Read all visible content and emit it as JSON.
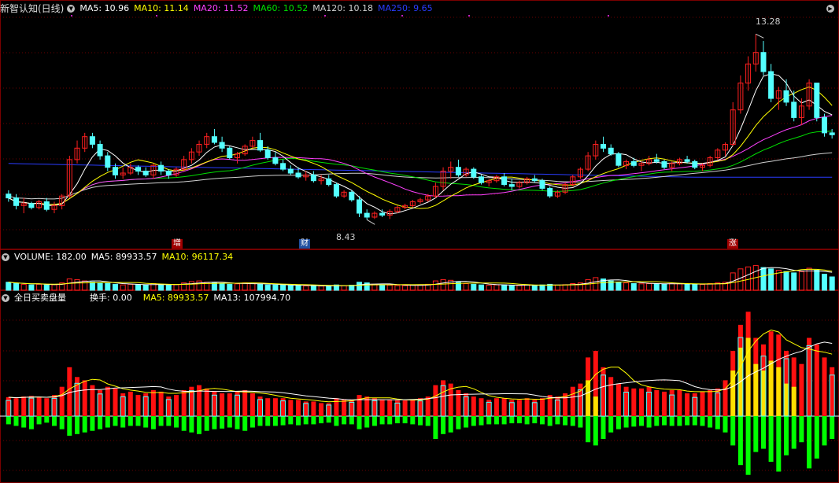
{
  "price_header": {
    "title": "新智认知(日线)",
    "ma5": "MA5: 10.96",
    "ma10": "MA10: 11.14",
    "ma20": "MA20: 11.52",
    "ma60": "MA60: 10.52",
    "ma120": "MA120: 10.18",
    "ma250": "MA250: 9.65"
  },
  "volume_header": {
    "label": "VOLUME: 182.00",
    "ma5": "MA5: 89933.57",
    "ma10": "MA10: 96117.34"
  },
  "flow_header": {
    "label": "全日买卖盘量",
    "turnover": "换手: 0.00",
    "ma5": "MA5: 89933.57",
    "ma13": "MA13: 107994.70"
  },
  "markers": {
    "zeng": "增",
    "cai": "财",
    "zhang": "涨"
  },
  "annotations": {
    "high": "13.28",
    "low": "8.43"
  },
  "colors": {
    "up": "#ff2020",
    "down": "#54ffff",
    "ma5": "#ffffff",
    "ma10": "#ffff00",
    "ma20": "#ff40ff",
    "ma60": "#00e000",
    "ma120": "#d0d0d0",
    "ma250": "#2a3cff",
    "grid": "#6a0000",
    "buy": "#ff1010",
    "sell": "#00ff00",
    "large": "#ffe000"
  },
  "chart_data": {
    "type": "candlestick",
    "price_range": [
      7.8,
      13.8
    ],
    "ohlc": [
      [
        9.1,
        9.2,
        8.9,
        9.0
      ],
      [
        9.0,
        9.1,
        8.7,
        8.8
      ],
      [
        8.8,
        9.0,
        8.6,
        8.85
      ],
      [
        8.85,
        8.9,
        8.7,
        8.75
      ],
      [
        8.75,
        8.95,
        8.7,
        8.9
      ],
      [
        8.9,
        9.0,
        8.65,
        8.7
      ],
      [
        8.7,
        8.9,
        8.6,
        8.8
      ],
      [
        8.8,
        9.1,
        8.7,
        9.05
      ],
      [
        9.05,
        10.1,
        9.0,
        10.0
      ],
      [
        10.0,
        10.5,
        9.9,
        10.3
      ],
      [
        10.3,
        10.7,
        10.2,
        10.6
      ],
      [
        10.6,
        10.7,
        10.3,
        10.4
      ],
      [
        10.4,
        10.5,
        10.0,
        10.1
      ],
      [
        10.1,
        10.2,
        9.7,
        9.8
      ],
      [
        9.8,
        9.9,
        9.5,
        9.6
      ],
      [
        9.6,
        9.8,
        9.5,
        9.65
      ],
      [
        9.65,
        9.9,
        9.6,
        9.8
      ],
      [
        9.8,
        9.85,
        9.6,
        9.7
      ],
      [
        9.7,
        9.8,
        9.55,
        9.6
      ],
      [
        9.6,
        9.9,
        9.5,
        9.85
      ],
      [
        9.85,
        9.95,
        9.6,
        9.7
      ],
      [
        9.7,
        9.75,
        9.5,
        9.6
      ],
      [
        9.6,
        9.8,
        9.55,
        9.75
      ],
      [
        9.75,
        10.1,
        9.7,
        10.0
      ],
      [
        10.0,
        10.3,
        9.9,
        10.2
      ],
      [
        10.2,
        10.5,
        10.1,
        10.4
      ],
      [
        10.4,
        10.7,
        10.3,
        10.6
      ],
      [
        10.6,
        10.8,
        10.4,
        10.45
      ],
      [
        10.45,
        10.6,
        10.2,
        10.3
      ],
      [
        10.3,
        10.35,
        10.0,
        10.05
      ],
      [
        10.05,
        10.2,
        9.9,
        10.15
      ],
      [
        10.15,
        10.4,
        10.1,
        10.35
      ],
      [
        10.35,
        10.6,
        10.3,
        10.5
      ],
      [
        10.5,
        10.7,
        10.2,
        10.25
      ],
      [
        10.25,
        10.35,
        10.0,
        10.05
      ],
      [
        10.05,
        10.2,
        9.85,
        9.9
      ],
      [
        9.9,
        10.0,
        9.7,
        9.75
      ],
      [
        9.75,
        9.85,
        9.6,
        9.65
      ],
      [
        9.65,
        9.8,
        9.5,
        9.55
      ],
      [
        9.55,
        9.7,
        9.45,
        9.6
      ],
      [
        9.6,
        9.7,
        9.4,
        9.45
      ],
      [
        9.45,
        9.6,
        9.35,
        9.5
      ],
      [
        9.5,
        9.6,
        9.3,
        9.35
      ],
      [
        9.35,
        9.4,
        9.0,
        9.05
      ],
      [
        9.05,
        9.2,
        9.0,
        9.15
      ],
      [
        9.15,
        9.2,
        8.9,
        8.95
      ],
      [
        8.95,
        9.05,
        8.5,
        8.6
      ],
      [
        8.6,
        8.7,
        8.43,
        8.5
      ],
      [
        8.5,
        8.65,
        8.45,
        8.6
      ],
      [
        8.6,
        8.7,
        8.5,
        8.55
      ],
      [
        8.55,
        8.7,
        8.45,
        8.65
      ],
      [
        8.65,
        8.8,
        8.6,
        8.75
      ],
      [
        8.75,
        8.85,
        8.7,
        8.8
      ],
      [
        8.8,
        8.95,
        8.75,
        8.9
      ],
      [
        8.9,
        9.0,
        8.85,
        8.95
      ],
      [
        8.95,
        9.1,
        8.9,
        9.05
      ],
      [
        9.05,
        9.4,
        9.0,
        9.3
      ],
      [
        9.3,
        9.8,
        9.2,
        9.7
      ],
      [
        9.7,
        9.95,
        9.5,
        9.8
      ],
      [
        9.8,
        10.0,
        9.55,
        9.6
      ],
      [
        9.6,
        9.8,
        9.55,
        9.75
      ],
      [
        9.75,
        9.8,
        9.5,
        9.55
      ],
      [
        9.55,
        9.6,
        9.35,
        9.4
      ],
      [
        9.4,
        9.5,
        9.3,
        9.45
      ],
      [
        9.45,
        9.6,
        9.4,
        9.55
      ],
      [
        9.55,
        9.65,
        9.3,
        9.35
      ],
      [
        9.35,
        9.5,
        9.2,
        9.3
      ],
      [
        9.3,
        9.45,
        9.25,
        9.4
      ],
      [
        9.4,
        9.55,
        9.35,
        9.5
      ],
      [
        9.5,
        9.6,
        9.4,
        9.45
      ],
      [
        9.45,
        9.5,
        9.2,
        9.25
      ],
      [
        9.25,
        9.3,
        9.0,
        9.05
      ],
      [
        9.05,
        9.2,
        9.0,
        9.15
      ],
      [
        9.15,
        9.4,
        9.1,
        9.35
      ],
      [
        9.35,
        9.6,
        9.3,
        9.55
      ],
      [
        9.55,
        9.8,
        9.5,
        9.75
      ],
      [
        9.75,
        10.2,
        9.7,
        10.1
      ],
      [
        10.1,
        10.5,
        10.0,
        10.4
      ],
      [
        10.4,
        10.6,
        10.2,
        10.3
      ],
      [
        10.3,
        10.4,
        10.1,
        10.15
      ],
      [
        10.15,
        10.2,
        9.8,
        9.85
      ],
      [
        9.85,
        10.0,
        9.75,
        9.95
      ],
      [
        9.95,
        10.05,
        9.8,
        9.85
      ],
      [
        9.85,
        9.95,
        9.7,
        9.9
      ],
      [
        9.9,
        10.1,
        9.85,
        10.0
      ],
      [
        10.0,
        10.15,
        9.9,
        9.95
      ],
      [
        9.95,
        10.0,
        9.75,
        9.8
      ],
      [
        9.8,
        9.95,
        9.7,
        9.9
      ],
      [
        9.9,
        10.05,
        9.85,
        10.0
      ],
      [
        10.0,
        10.1,
        9.9,
        9.95
      ],
      [
        9.95,
        10.0,
        9.75,
        9.8
      ],
      [
        9.8,
        9.9,
        9.7,
        9.85
      ],
      [
        9.85,
        10.1,
        9.8,
        10.05
      ],
      [
        10.05,
        10.3,
        10.0,
        10.25
      ],
      [
        10.25,
        10.45,
        10.1,
        10.4
      ],
      [
        10.4,
        11.5,
        10.35,
        11.3
      ],
      [
        11.3,
        12.2,
        11.2,
        12.0
      ],
      [
        12.0,
        12.7,
        11.8,
        12.5
      ],
      [
        12.5,
        13.28,
        12.3,
        12.8
      ],
      [
        12.8,
        13.1,
        12.2,
        12.3
      ],
      [
        12.3,
        12.5,
        11.5,
        11.6
      ],
      [
        11.6,
        11.9,
        11.3,
        11.8
      ],
      [
        11.8,
        12.1,
        11.4,
        11.5
      ],
      [
        11.5,
        11.8,
        11.0,
        11.1
      ],
      [
        11.1,
        11.6,
        10.9,
        11.4
      ],
      [
        11.4,
        12.1,
        11.3,
        12.0
      ],
      [
        12.0,
        12.0,
        11.0,
        11.1
      ],
      [
        11.1,
        11.2,
        10.6,
        10.7
      ],
      [
        10.7,
        10.8,
        10.55,
        10.65
      ]
    ],
    "volume": [
      60,
      50,
      45,
      40,
      45,
      40,
      42,
      55,
      85,
      80,
      70,
      60,
      55,
      50,
      45,
      40,
      45,
      40,
      38,
      50,
      45,
      40,
      42,
      55,
      65,
      70,
      60,
      55,
      50,
      45,
      48,
      55,
      50,
      45,
      40,
      40,
      38,
      35,
      35,
      33,
      35,
      32,
      30,
      40,
      35,
      38,
      60,
      55,
      45,
      40,
      38,
      35,
      35,
      38,
      40,
      45,
      70,
      80,
      75,
      60,
      50,
      45,
      40,
      38,
      40,
      40,
      35,
      35,
      40,
      38,
      40,
      45,
      38,
      42,
      50,
      55,
      80,
      95,
      85,
      70,
      60,
      55,
      50,
      48,
      50,
      48,
      45,
      50,
      48,
      46,
      45,
      44,
      50,
      55,
      60,
      130,
      160,
      175,
      185,
      170,
      160,
      150,
      140,
      130,
      140,
      165,
      150,
      120,
      100
    ],
    "buy": [
      58,
      55,
      60,
      62,
      58,
      55,
      65,
      90,
      150,
      120,
      110,
      95,
      80,
      90,
      85,
      70,
      75,
      65,
      70,
      80,
      75,
      60,
      65,
      80,
      90,
      95,
      85,
      75,
      70,
      70,
      75,
      80,
      70,
      60,
      55,
      55,
      55,
      50,
      50,
      45,
      45,
      40,
      40,
      55,
      50,
      50,
      65,
      60,
      55,
      50,
      50,
      48,
      48,
      50,
      55,
      60,
      95,
      110,
      100,
      80,
      70,
      60,
      55,
      50,
      55,
      55,
      50,
      50,
      55,
      50,
      55,
      65,
      60,
      70,
      90,
      100,
      180,
      200,
      150,
      120,
      100,
      90,
      85,
      85,
      90,
      80,
      75,
      80,
      80,
      70,
      70,
      75,
      80,
      85,
      110,
      200,
      280,
      320,
      240,
      220,
      260,
      250,
      200,
      180,
      160,
      240,
      220,
      180,
      150
    ],
    "sell": [
      -25,
      -30,
      -35,
      -40,
      -25,
      -20,
      -30,
      -40,
      -60,
      -55,
      -50,
      -45,
      -40,
      -35,
      -30,
      -35,
      -30,
      -30,
      -35,
      -40,
      -30,
      -30,
      -35,
      -45,
      -50,
      -55,
      -45,
      -40,
      -38,
      -35,
      -40,
      -45,
      -35,
      -30,
      -30,
      -30,
      -28,
      -25,
      -28,
      -25,
      -25,
      -22,
      -20,
      -30,
      -25,
      -25,
      -40,
      -35,
      -30,
      -25,
      -25,
      -22,
      -22,
      -25,
      -28,
      -30,
      -70,
      -55,
      -50,
      -40,
      -35,
      -30,
      -28,
      -25,
      -25,
      -25,
      -22,
      -22,
      -25,
      -22,
      -25,
      -30,
      -25,
      -28,
      -30,
      -35,
      -80,
      -90,
      -70,
      -50,
      -40,
      -35,
      -32,
      -30,
      -35,
      -30,
      -28,
      -30,
      -30,
      -28,
      -28,
      -30,
      -35,
      -40,
      -50,
      -90,
      -150,
      -180,
      -110,
      -100,
      -140,
      -170,
      -120,
      -100,
      -80,
      -160,
      -130,
      -90,
      -70
    ],
    "large": [
      0,
      0,
      0,
      0,
      0,
      0,
      0,
      0,
      0,
      0,
      0,
      0,
      0,
      0,
      0,
      0,
      0,
      0,
      0,
      0,
      0,
      0,
      0,
      0,
      0,
      0,
      0,
      0,
      0,
      0,
      0,
      0,
      0,
      0,
      0,
      0,
      0,
      0,
      0,
      0,
      0,
      0,
      0,
      0,
      0,
      0,
      0,
      0,
      0,
      0,
      0,
      0,
      0,
      0,
      0,
      0,
      0,
      0,
      0,
      0,
      0,
      0,
      0,
      0,
      0,
      0,
      0,
      0,
      0,
      0,
      0,
      0,
      0,
      0,
      0,
      0,
      110,
      60,
      0,
      0,
      0,
      0,
      0,
      0,
      0,
      0,
      0,
      0,
      0,
      0,
      0,
      0,
      0,
      0,
      0,
      140,
      210,
      240,
      160,
      140,
      170,
      150,
      100,
      90,
      0,
      0,
      0,
      0,
      0
    ],
    "flow_range": [
      -200,
      340
    ],
    "volume_range": [
      0,
      200
    ]
  }
}
